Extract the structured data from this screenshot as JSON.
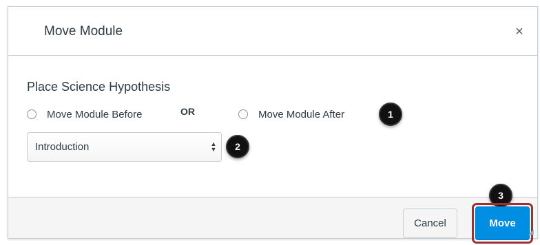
{
  "dialog": {
    "title": "Move Module",
    "close_label": "×"
  },
  "form": {
    "section_title": "Place Science Hypothesis",
    "radio_before_label": "Move Module Before",
    "or_label": "OR",
    "radio_after_label": "Move Module After",
    "select_value": "Introduction",
    "select_arrows": "▲▼"
  },
  "badges": {
    "one": "1",
    "two": "2",
    "three": "3"
  },
  "footer": {
    "cancel_label": "Cancel",
    "move_label": "Move"
  },
  "colors": {
    "primary": "#008ee2",
    "highlight_outline": "#a12f2f",
    "text": "#2d3b45"
  }
}
